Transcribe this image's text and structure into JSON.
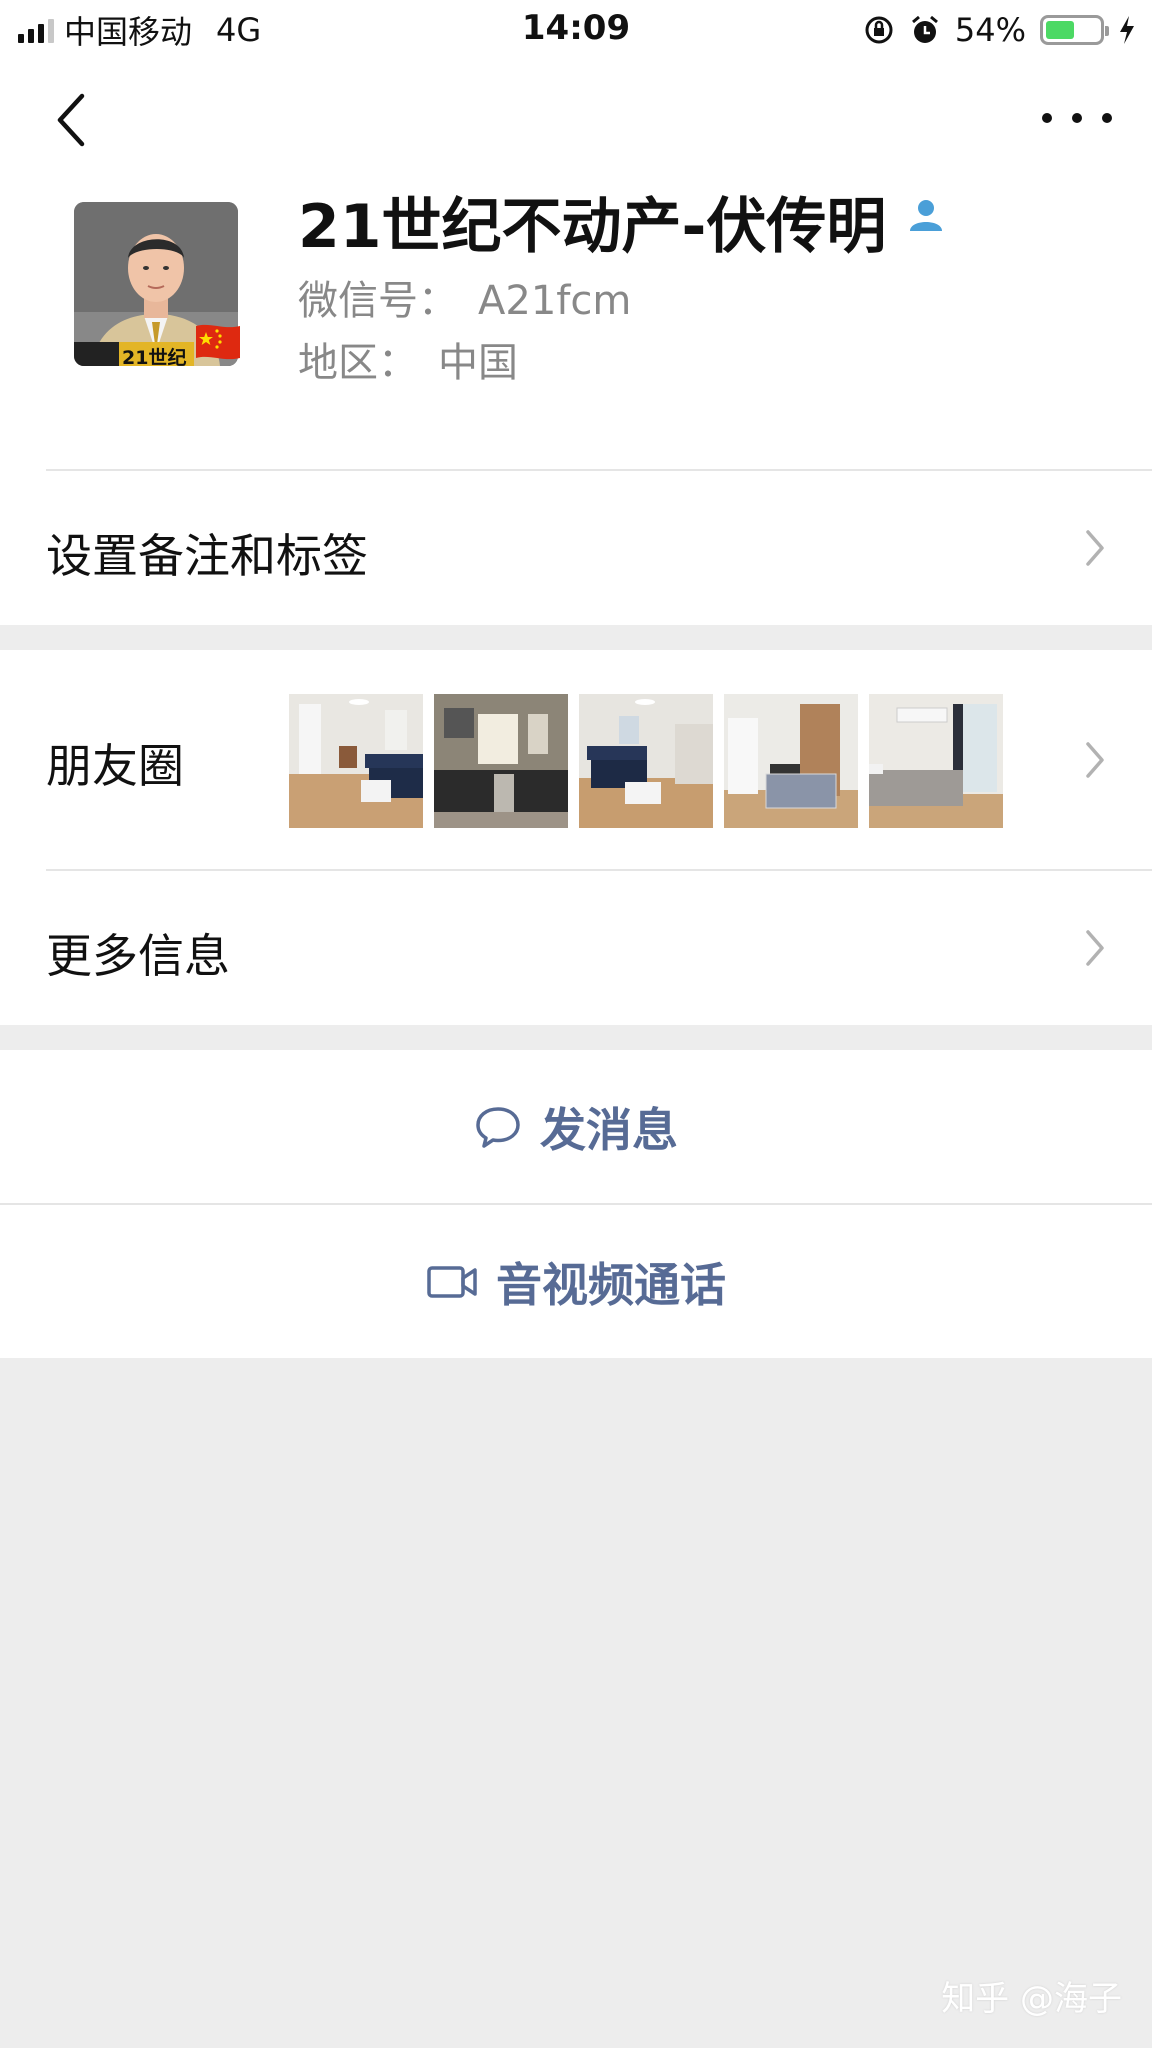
{
  "status_bar": {
    "carrier": "中国移动",
    "network": "4G",
    "time": "14:09",
    "battery_percent": "54%",
    "battery_level": 0.54,
    "battery_color": "#4cd964"
  },
  "nav": {
    "back_icon": "chevron-left-icon",
    "more_icon": "ellipsis-icon"
  },
  "profile": {
    "name": "21世纪不动产-伏传明",
    "avatar_badge_text": "21世纪",
    "wechat_id_label": "微信号：",
    "wechat_id": "A21fcm",
    "region_label": "地区：",
    "region": "中国"
  },
  "rows": {
    "remark": "设置备注和标签",
    "moments": "朋友圈",
    "more_info": "更多信息"
  },
  "moments_photos": [
    {
      "name": "living-room-sofa"
    },
    {
      "name": "kitchen"
    },
    {
      "name": "living-room-dark-sofa"
    },
    {
      "name": "bedroom-wardrobe"
    },
    {
      "name": "bedroom-ac"
    }
  ],
  "actions": {
    "message": "发消息",
    "call": "音视频通话"
  },
  "colors": {
    "link_blue": "#576b95",
    "background": "#ededed"
  },
  "watermark": "知乎 @海子"
}
